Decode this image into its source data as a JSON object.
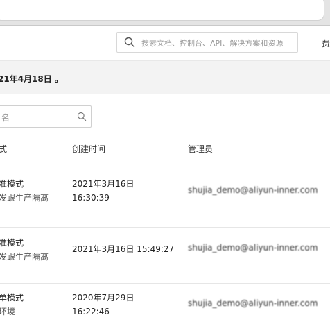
{
  "header": {
    "search_placeholder": "搜索文档、控制台、API、解决方案和资源",
    "fee_label": "费"
  },
  "notice": {
    "text": "21年4月18日 。"
  },
  "filter": {
    "placeholder": "名"
  },
  "table": {
    "columns": [
      "式",
      "创建时间",
      "管理员"
    ],
    "rows": [
      {
        "mode": "准模式",
        "mode_desc": "发跟生产隔离",
        "created_line1": "2021年3月16日",
        "created_line2": "16:30:39",
        "admin": "shujia_demo@aliyun-inner.com"
      },
      {
        "mode": "准模式",
        "mode_desc": "发跟生产隔离",
        "created_line1": "2021年3月16日 15:49:27",
        "created_line2": "",
        "admin": "shujia_demo@aliyun-inner.com"
      },
      {
        "mode": "单模式",
        "mode_desc": "环境",
        "created_line1": "2020年7月29日",
        "created_line2": "16:22:46",
        "admin": "shujia_demo@aliyun-inner.com"
      }
    ]
  },
  "colors": {
    "notice_bg": "#f3f3f3",
    "border": "#e6e6e6",
    "text": "#222222"
  }
}
